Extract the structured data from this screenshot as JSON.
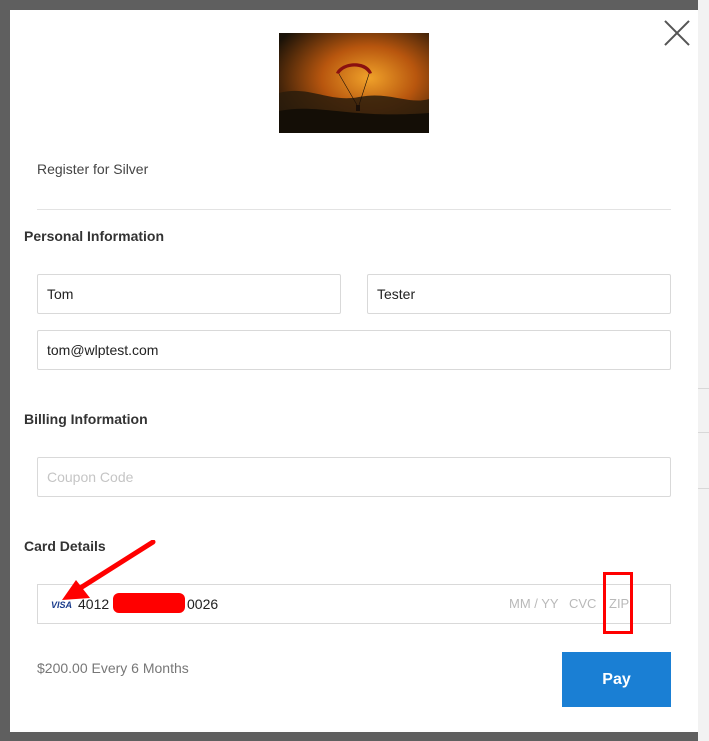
{
  "modal": {
    "register_text": "Register for Silver"
  },
  "personal": {
    "title": "Personal Information",
    "first_name": "Tom",
    "last_name": "Tester",
    "email": "tom@wlptest.com"
  },
  "billing": {
    "title": "Billing Information",
    "coupon_placeholder": "Coupon Code"
  },
  "card": {
    "title": "Card Details",
    "brand": "VISA",
    "number_first": "4012",
    "number_last": "0026",
    "expiry_placeholder": "MM / YY",
    "cvc_placeholder": "CVC",
    "zip_placeholder": "ZIP"
  },
  "footer": {
    "price": "$200.00 Every 6 Months",
    "pay_label": "Pay"
  },
  "colors": {
    "accent": "#1a7fd4",
    "annotation": "#ff0000"
  },
  "icons": {
    "close": "close-icon",
    "card_brand": "visa-icon"
  }
}
